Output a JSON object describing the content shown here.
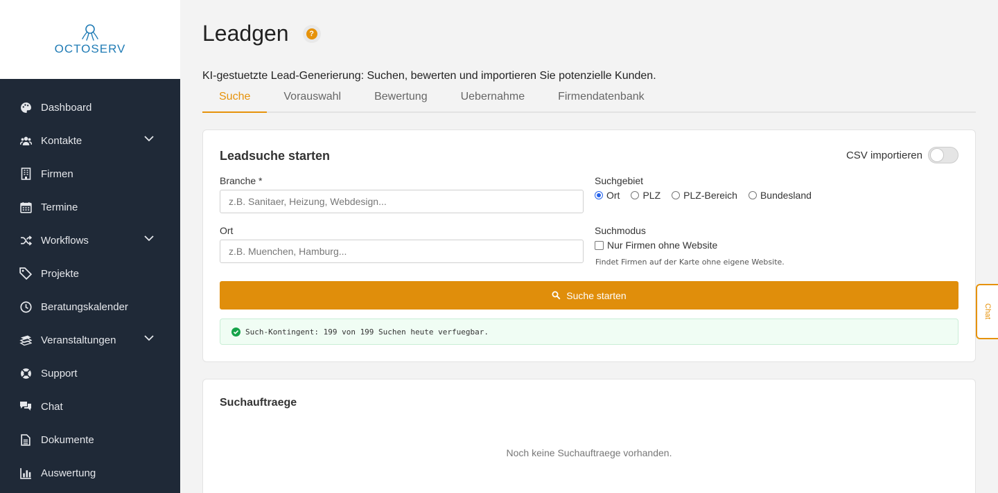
{
  "brand": {
    "name": "OCTOSERV",
    "color": "#1f7bb5"
  },
  "colors": {
    "accent": "#e08e0b",
    "sidebar": "#1f2937",
    "success": "#16a34a"
  },
  "sidebar": {
    "items": [
      {
        "label": "Dashboard",
        "icon": "palette-icon"
      },
      {
        "label": "Kontakte",
        "icon": "users-icon"
      },
      {
        "label": "Firmen",
        "icon": "building-icon"
      },
      {
        "label": "Termine",
        "icon": "calendar-icon"
      },
      {
        "label": "Workflows",
        "icon": "shuffle-icon"
      },
      {
        "label": "Projekte",
        "icon": "tag-icon"
      },
      {
        "label": "Beratungskalender",
        "icon": "clock-icon"
      },
      {
        "label": "Veranstaltungen",
        "icon": "layers-icon"
      },
      {
        "label": "Support",
        "icon": "lifebuoy-icon"
      },
      {
        "label": "Chat",
        "icon": "chat-bubbles-icon"
      },
      {
        "label": "Dokumente",
        "icon": "document-icon"
      },
      {
        "label": "Auswertung",
        "icon": "bar-chart-icon"
      }
    ]
  },
  "page": {
    "title": "Leadgen",
    "subtitle": "KI-gestuetzte Lead-Generierung: Suchen, bewerten und importieren Sie potenzielle Kunden."
  },
  "tabs": [
    "Suche",
    "Vorauswahl",
    "Bewertung",
    "Uebernahme",
    "Firmendatenbank"
  ],
  "search_card": {
    "title": "Leadsuche starten",
    "csv_label": "CSV importieren",
    "branche_label": "Branche *",
    "branche_placeholder": "z.B. Sanitaer, Heizung, Webdesign...",
    "ort_label": "Ort",
    "ort_placeholder": "z.B. Muenchen, Hamburg...",
    "suchgebiet_label": "Suchgebiet",
    "suchgebiet_options": [
      "Ort",
      "PLZ",
      "PLZ-Bereich",
      "Bundesland"
    ],
    "suchgebiet_selected": "Ort",
    "suchmodus_label": "Suchmodus",
    "suchmodus_checkbox": "Nur Firmen ohne Website",
    "suchmodus_hint": "Findet Firmen auf der Karte ohne eigene Website.",
    "button_label": "Suche starten",
    "quota_text": "Such-Kontingent: 199 von 199 Suchen heute verfuegbar."
  },
  "jobs_card": {
    "title": "Suchauftraege",
    "empty_text": "Noch keine Suchauftraege vorhanden."
  },
  "chat_tab": {
    "label": "Chat"
  }
}
